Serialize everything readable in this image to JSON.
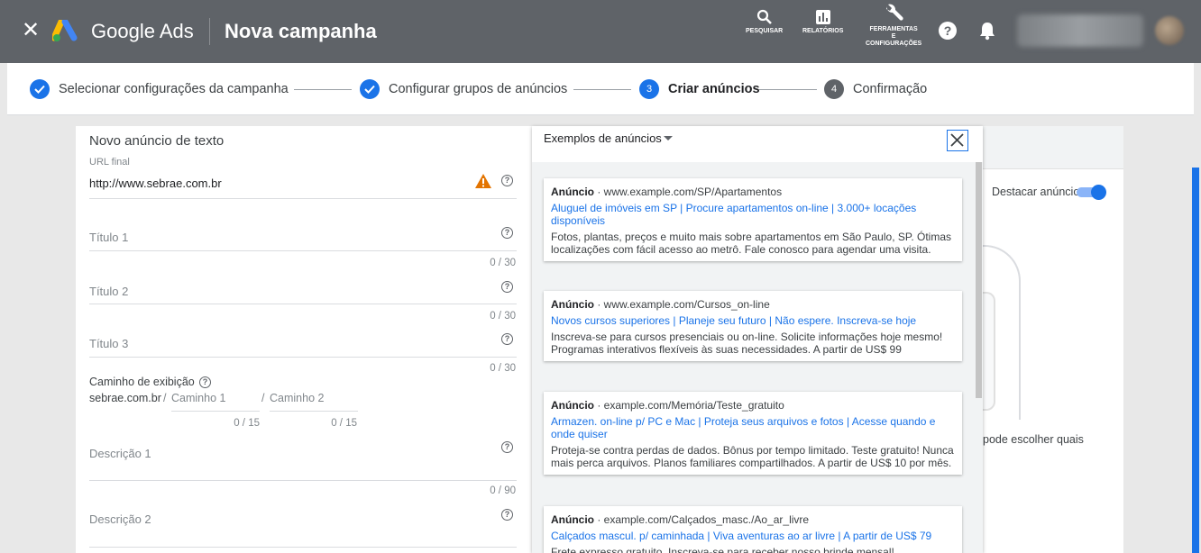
{
  "header": {
    "brand": "Google Ads",
    "title": "Nova campanha",
    "tools": [
      {
        "label": "PESQUISAR"
      },
      {
        "label": "RELATÓRIOS"
      },
      {
        "label_1": "FERRAMENTAS",
        "label_2": "E",
        "label_3": "CONFIGURAÇÕES"
      }
    ]
  },
  "steps": [
    {
      "label": "Selecionar configurações da campanha",
      "state": "done"
    },
    {
      "label": "Configurar grupos de anúncios",
      "state": "done"
    },
    {
      "number": "3",
      "label": "Criar anúncios",
      "state": "active"
    },
    {
      "number": "4",
      "label": "Confirmação",
      "state": "pending"
    }
  ],
  "form": {
    "title": "Novo anúncio de texto",
    "url_label": "URL final",
    "url_value": "http://www.sebrae.com.br",
    "titulo1": "Título 1",
    "titulo1_count": "0 / 30",
    "titulo2": "Título 2",
    "titulo2_count": "0 / 30",
    "titulo3": "Título 3",
    "titulo3_count": "0 / 30",
    "path_label": "Caminho de exibição",
    "path_domain": "sebrae.com.br",
    "path_sep1": "/",
    "path1": "Caminho 1",
    "path_sep2": "/",
    "path2": "Caminho 2",
    "path1_count": "0 / 15",
    "path2_count": "0 / 15",
    "desc1": "Descrição 1",
    "desc1_count": "0 / 90",
    "desc2": "Descrição 2"
  },
  "examples": {
    "title": "Exemplos de anúncios",
    "ads": [
      {
        "badge": "Anúncio",
        "url": " · www.example.com/SP/Apartamentos",
        "headline": "Aluguel de imóveis em SP | Procure apartamentos on-line | 3.000+ locações disponíveis",
        "description": "Fotos, plantas, preços e muito mais sobre apartamentos em São Paulo, SP. Ótimas localizações com fácil acesso ao metrô. Fale conosco para agendar uma visita."
      },
      {
        "badge": "Anúncio",
        "url": " · www.example.com/Cursos_on-line",
        "headline": "Novos cursos superiores | Planeje seu futuro | Não espere. Inscreva-se hoje",
        "description": "Inscreva-se para cursos presenciais ou on-line. Solicite informações hoje mesmo! Programas interativos flexíveis às suas necessidades. A partir de US$ 99"
      },
      {
        "badge": "Anúncio",
        "url": " · example.com/Memória/Teste_gratuito",
        "headline": "Armazen. on-line p/ PC e Mac | Proteja seus arquivos e fotos | Acesse quando e onde quiser",
        "description": "Proteja-se contra perdas de dados. Bônus por tempo limitado. Teste gratuito! Nunca mais perca arquivos. Planos familiares compartilhados. A partir de US$ 10 por mês."
      },
      {
        "badge": "Anúncio",
        "url": " · example.com/Calçados_masc./Ao_ar_livre",
        "headline": "Calçados mascul. p/ caminhada | Viva aventuras ao ar livre | A partir de US$ 79",
        "description": "Frete expresso gratuito. Inscreva-se para receber nosso brinde mensal!"
      }
    ]
  },
  "preview": {
    "highlight_label": "Destacar anúncio",
    "choose_text": "pode escolher quais"
  },
  "colors": {
    "header_bg": "#5f6368",
    "accent": "#1a73e8",
    "warning": "#e37400"
  }
}
